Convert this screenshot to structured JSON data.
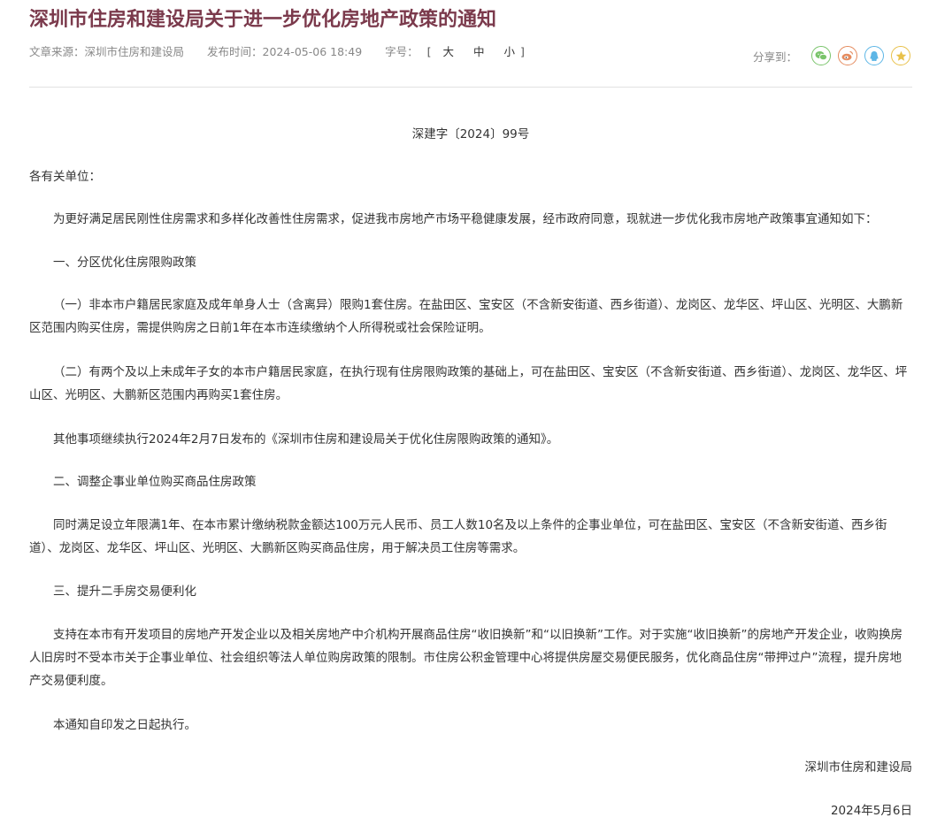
{
  "article": {
    "title": "深圳市住房和建设局关于进一步优化房地产政策的通知",
    "source": "文章来源：深圳市住房和建设局",
    "publish_time": "发布时间：2024-05-06 18:49",
    "font_size_label": "字号：",
    "font_size_open": "[",
    "font_size_large": "大",
    "font_size_medium": "中",
    "font_size_small": "小",
    "font_size_close": "]"
  },
  "share": {
    "label": "分享到：",
    "icons": [
      "wechat-icon",
      "weibo-icon",
      "qq-icon",
      "favorite-icon"
    ],
    "colors": {
      "wechat": "#7ac46b",
      "weibo": "#e58b5e",
      "qq": "#5db6e6",
      "favorite": "#e8c14a"
    }
  },
  "colors": {
    "title": "#7b3a4c",
    "text": "#333333",
    "meta": "#888888"
  },
  "body": {
    "doc_number": "深建字〔2024〕99号",
    "salutation": "各有关单位：",
    "intro": "为更好满足居民刚性住房需求和多样化改善性住房需求，促进我市房地产市场平稳健康发展，经市政府同意，现就进一步优化我市房地产政策事宜通知如下：",
    "section1_title": "一、分区优化住房限购政策",
    "section1_item1": "（一）非本市户籍居民家庭及成年单身人士（含离异）限购1套住房。在盐田区、宝安区（不含新安街道、西乡街道）、龙岗区、龙华区、坪山区、光明区、大鹏新区范围内购买住房，需提供购房之日前1年在本市连续缴纳个人所得税或社会保险证明。",
    "section1_item2": "（二）有两个及以上未成年子女的本市户籍居民家庭，在执行现有住房限购政策的基础上，可在盐田区、宝安区（不含新安街道、西乡街道）、龙岗区、龙华区、坪山区、光明区、大鹏新区范围内再购买1套住房。",
    "section1_other": "其他事项继续执行2024年2月7日发布的《深圳市住房和建设局关于优化住房限购政策的通知》。",
    "section2_title": "二、调整企事业单位购买商品住房政策",
    "section2_body": "同时满足设立年限满1年、在本市累计缴纳税款金额达100万元人民币、员工人数10名及以上条件的企事业单位，可在盐田区、宝安区（不含新安街道、西乡街道）、龙岗区、龙华区、坪山区、光明区、大鹏新区购买商品住房，用于解决员工住房等需求。",
    "section3_title": "三、提升二手房交易便利化",
    "section3_body": "支持在本市有开发项目的房地产开发企业以及相关房地产中介机构开展商品住房“收旧换新”和“以旧换新”工作。对于实施“收旧换新”的房地产开发企业，收购换房人旧房时不受本市关于企事业单位、社会组织等法人单位购房政策的限制。市住房公积金管理中心将提供房屋交易便民服务，优化商品住房“带押过户”流程，提升房地产交易便利度。",
    "effective": "本通知自印发之日起执行。",
    "signature": "深圳市住房和建设局",
    "date": "2024年5月6日"
  }
}
